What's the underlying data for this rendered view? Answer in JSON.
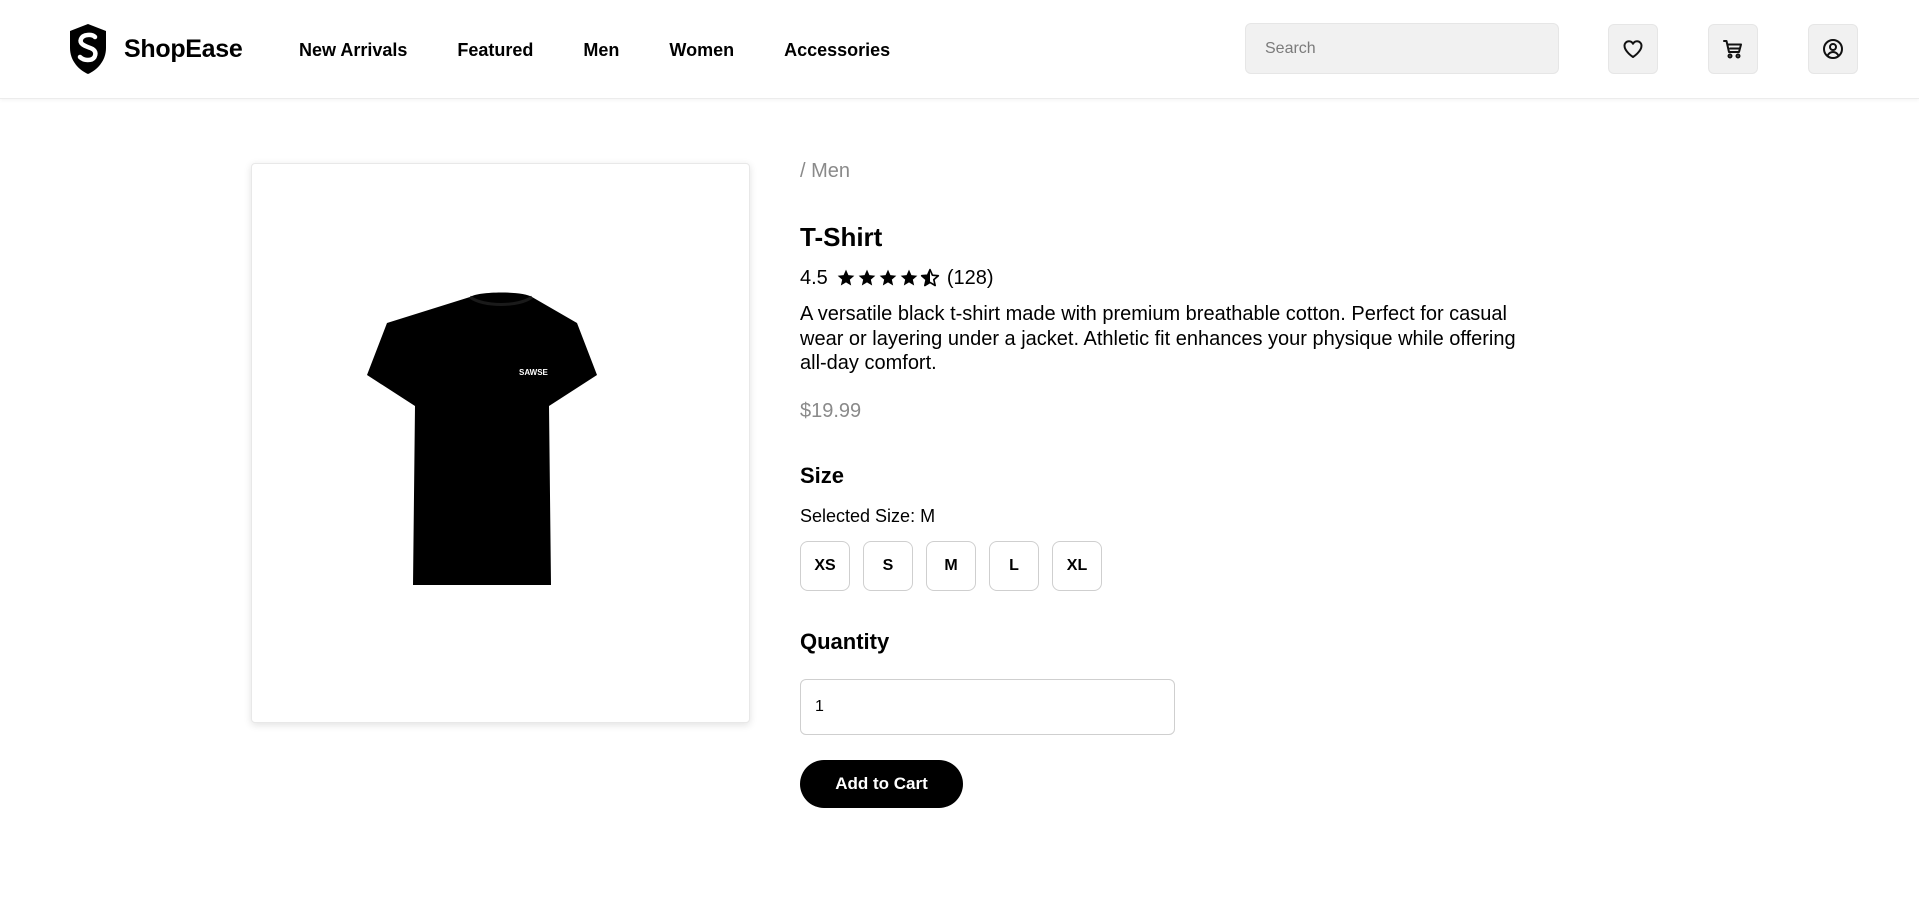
{
  "header": {
    "brand": "ShopEase",
    "nav": [
      "New Arrivals",
      "Featured",
      "Men",
      "Women",
      "Accessories"
    ],
    "search_placeholder": "Search",
    "icons": [
      "heart-icon",
      "cart-icon",
      "user-icon"
    ]
  },
  "product": {
    "breadcrumb": "/ Men",
    "title": "T-Shirt",
    "rating": "4.5",
    "rating_value": 4.5,
    "rating_max": 5,
    "review_count": "(128)",
    "description": "A versatile black t-shirt made with premium breathable cotton. Perfect for casual wear or layering under a jacket. Athletic fit enhances your physique while offering all-day comfort.",
    "price": "$19.99",
    "image_logo_text": "SAWSE"
  },
  "size": {
    "label": "Size",
    "selected_text": "Selected Size: M",
    "options": [
      "XS",
      "S",
      "M",
      "L",
      "XL"
    ]
  },
  "quantity": {
    "label": "Quantity",
    "value": "1"
  },
  "actions": {
    "add_to_cart": "Add to Cart"
  },
  "colors": {
    "accent": "#000000",
    "muted_text": "#8a8a8a",
    "field_bg": "#f1f1f1"
  }
}
